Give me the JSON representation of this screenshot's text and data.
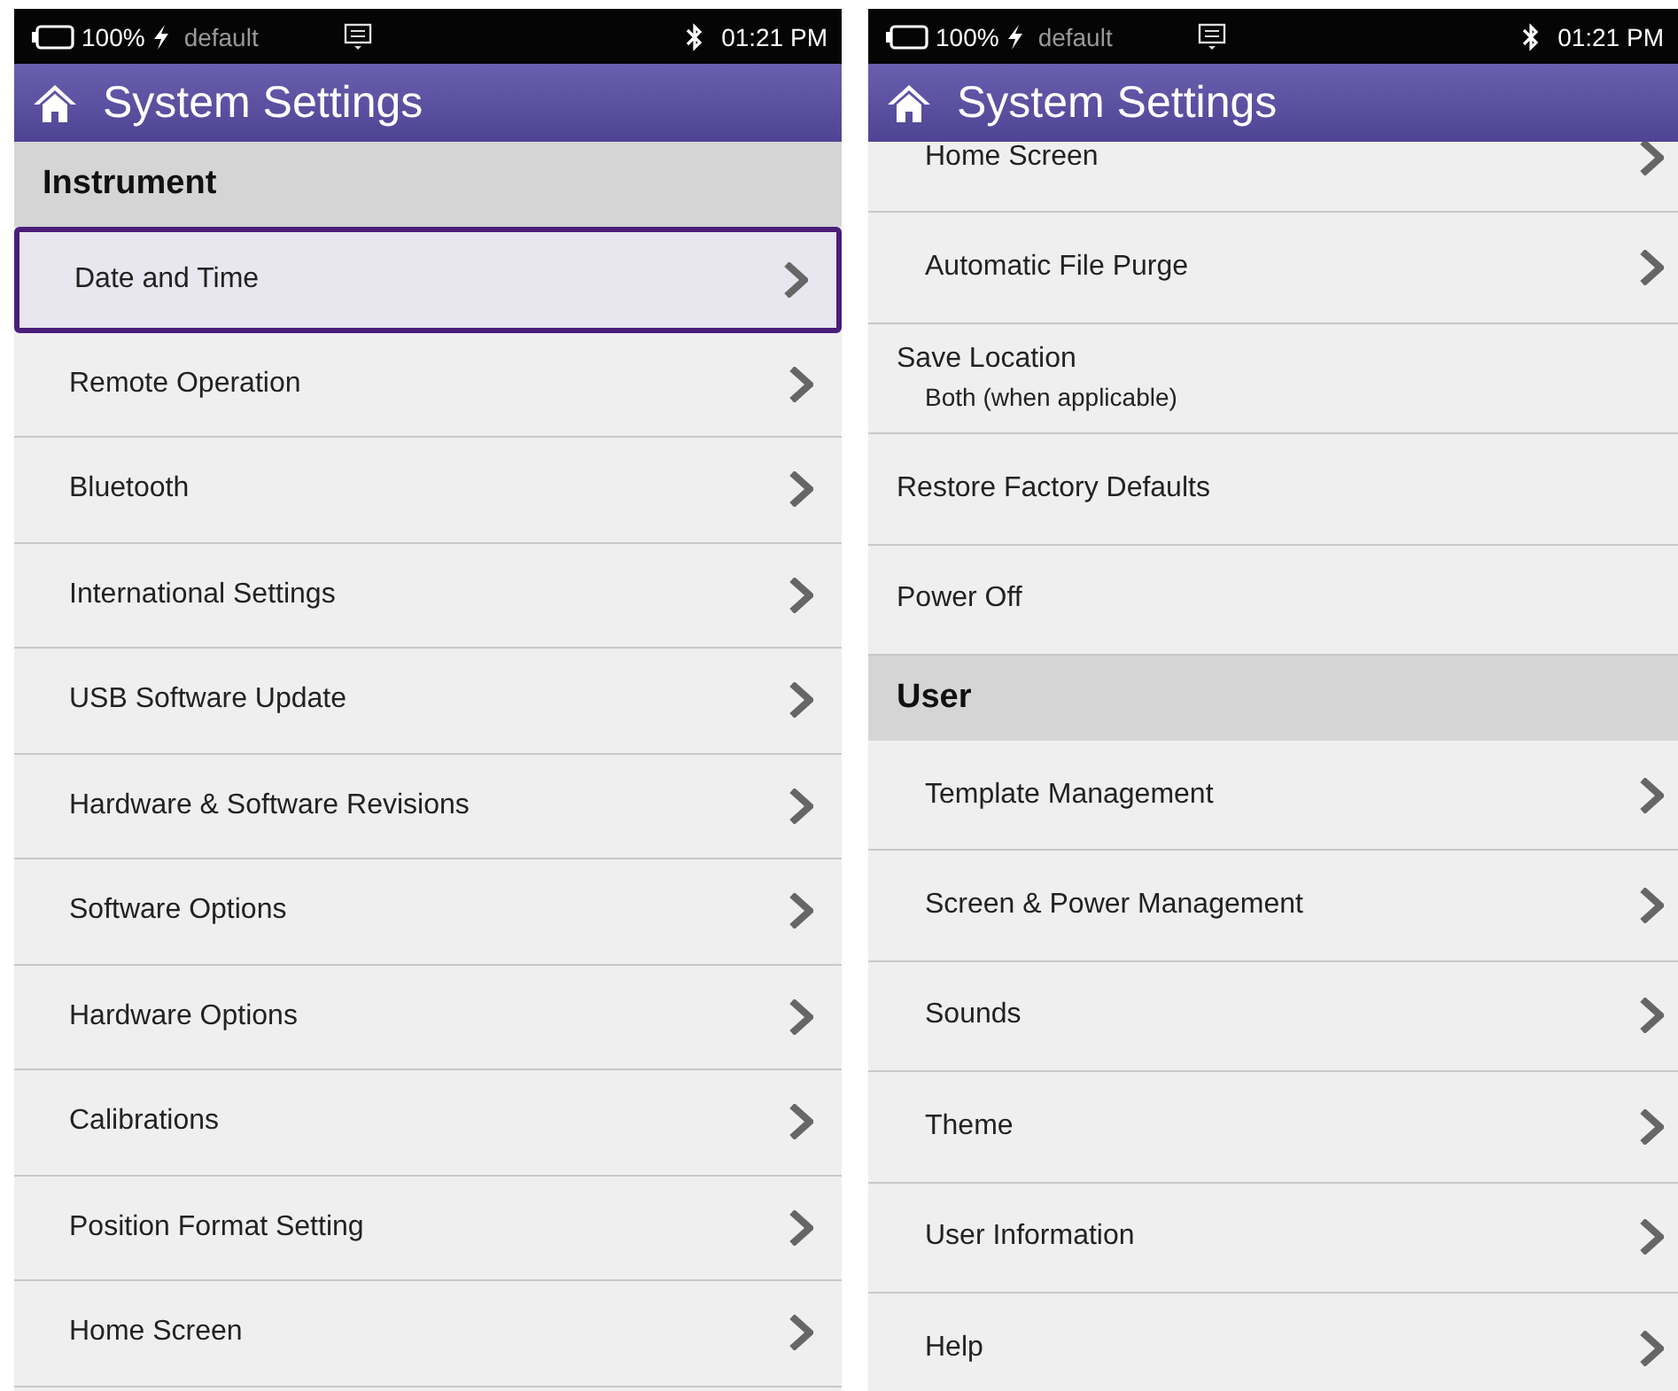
{
  "screens": [
    {
      "status_bar": {
        "battery": "100%",
        "profile": "default",
        "time": "01:21 PM"
      },
      "title": "System Settings",
      "scrolled": false,
      "items": [
        {
          "kind": "header",
          "label": "Instrument"
        },
        {
          "kind": "nav",
          "label": "Date and Time",
          "selected": true
        },
        {
          "kind": "nav",
          "label": "Remote Operation",
          "selected": false
        },
        {
          "kind": "nav",
          "label": "Bluetooth",
          "selected": false
        },
        {
          "kind": "nav",
          "label": "International Settings",
          "selected": false
        },
        {
          "kind": "nav",
          "label": "USB Software Update",
          "selected": false
        },
        {
          "kind": "nav",
          "label": "Hardware & Software Revisions",
          "selected": false
        },
        {
          "kind": "nav",
          "label": "Software Options",
          "selected": false
        },
        {
          "kind": "nav",
          "label": "Hardware Options",
          "selected": false
        },
        {
          "kind": "nav",
          "label": "Calibrations",
          "selected": false
        },
        {
          "kind": "nav",
          "label": "Position Format Setting",
          "selected": false
        },
        {
          "kind": "nav",
          "label": "Home Screen",
          "selected": false
        }
      ]
    },
    {
      "status_bar": {
        "battery": "100%",
        "profile": "default",
        "time": "01:21 PM"
      },
      "title": "System Settings",
      "scrolled": true,
      "items": [
        {
          "kind": "nav",
          "label": "Home Screen",
          "selected": false
        },
        {
          "kind": "nav",
          "label": "Automatic File Purge",
          "selected": false
        },
        {
          "kind": "value",
          "label": "Save Location",
          "value": "Both (when applicable)",
          "selected": false
        },
        {
          "kind": "action",
          "label": "Restore Factory Defaults",
          "selected": false
        },
        {
          "kind": "action",
          "label": "Power Off",
          "selected": false
        },
        {
          "kind": "header",
          "label": "User"
        },
        {
          "kind": "nav",
          "label": "Template Management",
          "selected": false
        },
        {
          "kind": "nav",
          "label": "Screen & Power Management",
          "selected": false
        },
        {
          "kind": "nav",
          "label": "Sounds",
          "selected": false
        },
        {
          "kind": "nav",
          "label": "Theme",
          "selected": false
        },
        {
          "kind": "nav",
          "label": "User Information",
          "selected": false
        },
        {
          "kind": "nav",
          "label": "Help",
          "selected": false
        }
      ]
    }
  ]
}
